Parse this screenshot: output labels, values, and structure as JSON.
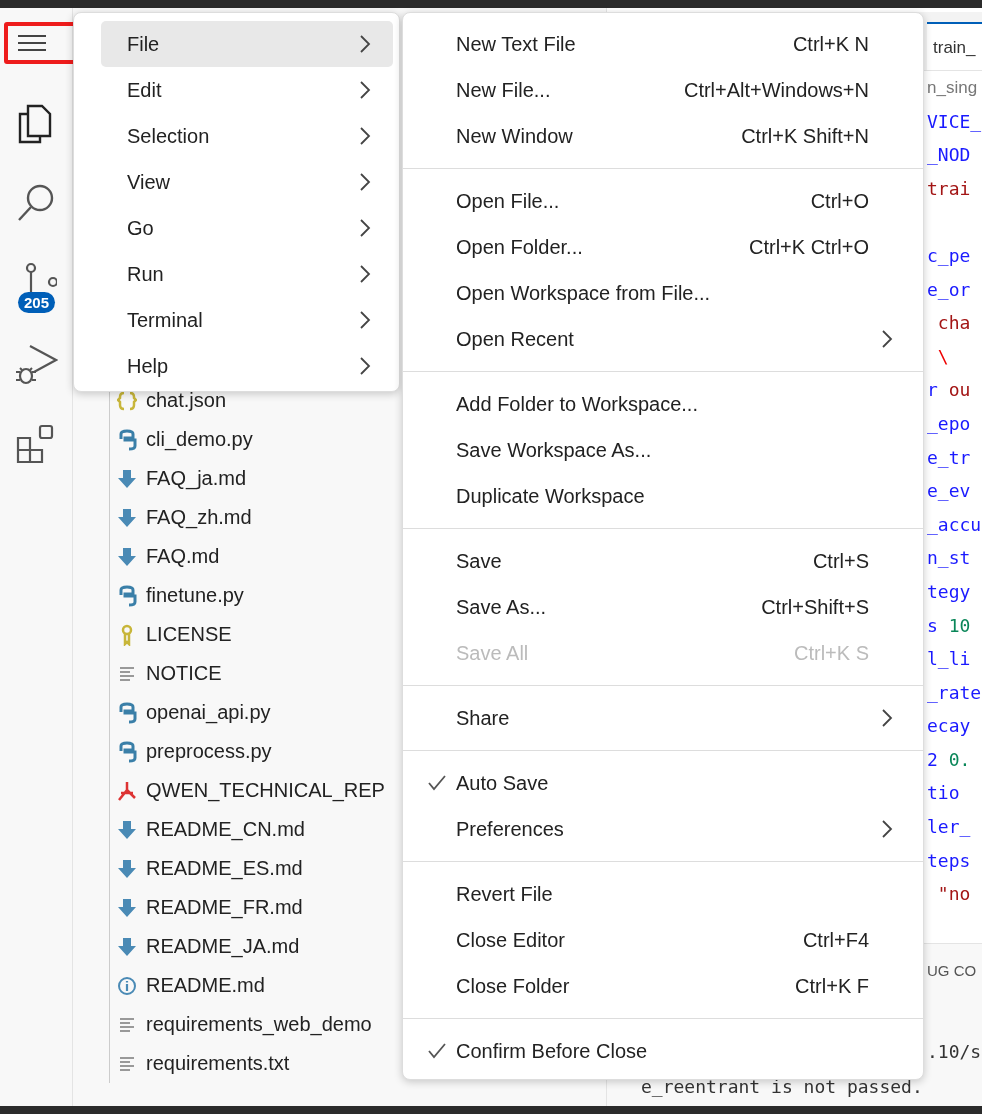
{
  "activity_bar": [
    {
      "kind": "menu",
      "highlighted": true
    },
    {
      "kind": "files",
      "highlighted": false
    },
    {
      "kind": "search",
      "highlighted": false
    },
    {
      "kind": "source-control",
      "highlighted": false,
      "badge": "205"
    },
    {
      "kind": "run-debug",
      "highlighted": false
    },
    {
      "kind": "extensions",
      "highlighted": false
    }
  ],
  "explorer": {
    "files": [
      {
        "kind": "json",
        "name": "chat.json"
      },
      {
        "kind": "python",
        "name": "cli_demo.py"
      },
      {
        "kind": "markdown",
        "name": "FAQ_ja.md"
      },
      {
        "kind": "markdown",
        "name": "FAQ_zh.md"
      },
      {
        "kind": "markdown",
        "name": "FAQ.md"
      },
      {
        "kind": "python",
        "name": "finetune.py"
      },
      {
        "kind": "license",
        "name": "LICENSE"
      },
      {
        "kind": "text",
        "name": "NOTICE"
      },
      {
        "kind": "python",
        "name": "openai_api.py"
      },
      {
        "kind": "python",
        "name": "preprocess.py"
      },
      {
        "kind": "pdf",
        "name": "QWEN_TECHNICAL_REP"
      },
      {
        "kind": "markdown",
        "name": "README_CN.md"
      },
      {
        "kind": "markdown",
        "name": "README_ES.md"
      },
      {
        "kind": "markdown",
        "name": "README_FR.md"
      },
      {
        "kind": "markdown",
        "name": "README_JA.md"
      },
      {
        "kind": "info",
        "name": "README.md"
      },
      {
        "kind": "text",
        "name": "requirements_web_demo"
      },
      {
        "kind": "text",
        "name": "requirements.txt"
      }
    ]
  },
  "editor": {
    "tab": "train_",
    "breadcrumb": "n_sing",
    "blocks": [
      [
        {
          "tokens": [
            {
              "kind": "var",
              "text": "VICE_"
            }
          ]
        },
        {
          "tokens": [
            {
              "kind": "var",
              "text": "_NOD"
            }
          ]
        },
        {
          "tokens": [
            {
              "kind": "string",
              "text": "trai"
            }
          ]
        }
      ],
      [
        {
          "tokens": [
            {
              "kind": "var",
              "text": "c_pe"
            }
          ]
        },
        {
          "tokens": [
            {
              "kind": "var",
              "text": "e_or"
            }
          ]
        },
        {
          "tokens": [
            {
              "kind": "string",
              "text": " cha"
            }
          ]
        },
        {
          "tokens": [
            {
              "kind": "escape",
              "text": " \\"
            }
          ]
        },
        {
          "tokens": [
            {
              "kind": "var",
              "text": "r"
            },
            {
              "kind": "string",
              "text": " ou"
            }
          ]
        },
        {
          "tokens": [
            {
              "kind": "var",
              "text": "_epo"
            }
          ]
        },
        {
          "tokens": [
            {
              "kind": "var",
              "text": "e_tr"
            }
          ]
        },
        {
          "tokens": [
            {
              "kind": "var",
              "text": "e_ev"
            }
          ]
        },
        {
          "tokens": [
            {
              "kind": "var",
              "text": "_accu"
            }
          ]
        },
        {
          "tokens": [
            {
              "kind": "var",
              "text": "n_st"
            }
          ]
        },
        {
          "tokens": [
            {
              "kind": "var",
              "text": "tegy"
            }
          ]
        },
        {
          "tokens": [
            {
              "kind": "var",
              "text": "s"
            },
            {
              "kind": "number",
              "text": " 10"
            }
          ]
        },
        {
          "tokens": [
            {
              "kind": "var",
              "text": "l_li"
            }
          ]
        },
        {
          "tokens": [
            {
              "kind": "var",
              "text": "_rate"
            }
          ]
        },
        {
          "tokens": [
            {
              "kind": "var",
              "text": "ecay"
            }
          ]
        },
        {
          "tokens": [
            {
              "kind": "var",
              "text": "2"
            },
            {
              "kind": "number",
              "text": " 0."
            }
          ]
        },
        {
          "tokens": [
            {
              "kind": "var",
              "text": "tio"
            }
          ]
        },
        {
          "tokens": [
            {
              "kind": "var",
              "text": "ler_"
            }
          ]
        },
        {
          "tokens": [
            {
              "kind": "var",
              "text": "teps"
            }
          ]
        },
        {
          "tokens": [
            {
              "kind": "string",
              "text": " \"no"
            }
          ]
        }
      ]
    ]
  },
  "panel": {
    "tab": "UG CO",
    "terminal": [
      ".10/s",
      "e_reentrant is not passed."
    ]
  },
  "menu": [
    {
      "label": "File",
      "selected": true
    },
    {
      "label": "Edit",
      "selected": false
    },
    {
      "label": "Selection",
      "selected": false
    },
    {
      "label": "View",
      "selected": false
    },
    {
      "label": "Go",
      "selected": false
    },
    {
      "label": "Run",
      "selected": false
    },
    {
      "label": "Terminal",
      "selected": false
    },
    {
      "label": "Help",
      "selected": false
    }
  ],
  "file_menu": [
    [
      {
        "kind": "command",
        "label": "New Text File",
        "shortcut": "Ctrl+K N",
        "checked": false,
        "disabled": false
      },
      {
        "kind": "command",
        "label": "New File...",
        "shortcut": "Ctrl+Alt+Windows+N",
        "checked": false,
        "disabled": false
      },
      {
        "kind": "command",
        "label": "New Window",
        "shortcut": "Ctrl+K Shift+N",
        "checked": false,
        "disabled": false
      }
    ],
    [
      {
        "kind": "command",
        "label": "Open File...",
        "shortcut": "Ctrl+O",
        "checked": false,
        "disabled": false
      },
      {
        "kind": "command",
        "label": "Open Folder...",
        "shortcut": "Ctrl+K Ctrl+O",
        "checked": false,
        "disabled": false
      },
      {
        "kind": "command",
        "label": "Open Workspace from File...",
        "checked": false,
        "disabled": false
      },
      {
        "kind": "submenu",
        "label": "Open Recent",
        "checked": false,
        "disabled": false
      }
    ],
    [
      {
        "kind": "command",
        "label": "Add Folder to Workspace...",
        "checked": false,
        "disabled": false
      },
      {
        "kind": "command",
        "label": "Save Workspace As...",
        "checked": false,
        "disabled": false
      },
      {
        "kind": "command",
        "label": "Duplicate Workspace",
        "checked": false,
        "disabled": false
      }
    ],
    [
      {
        "kind": "command",
        "label": "Save",
        "shortcut": "Ctrl+S",
        "checked": false,
        "disabled": false
      },
      {
        "kind": "command",
        "label": "Save As...",
        "shortcut": "Ctrl+Shift+S",
        "checked": false,
        "disabled": false
      },
      {
        "kind": "command",
        "label": "Save All",
        "shortcut": "Ctrl+K S",
        "checked": false,
        "disabled": true
      }
    ],
    [
      {
        "kind": "submenu",
        "label": "Share",
        "checked": false,
        "disabled": false
      }
    ],
    [
      {
        "kind": "command",
        "label": "Auto Save",
        "checked": true,
        "disabled": false
      },
      {
        "kind": "submenu",
        "label": "Preferences",
        "checked": false,
        "disabled": false
      }
    ],
    [
      {
        "kind": "command",
        "label": "Revert File",
        "checked": false,
        "disabled": false
      },
      {
        "kind": "command",
        "label": "Close Editor",
        "shortcut": "Ctrl+F4",
        "checked": false,
        "disabled": false
      },
      {
        "kind": "command",
        "label": "Close Folder",
        "shortcut": "Ctrl+K F",
        "checked": false,
        "disabled": false
      }
    ],
    [
      {
        "kind": "command",
        "label": "Confirm Before Close",
        "checked": true,
        "disabled": false
      }
    ]
  ]
}
